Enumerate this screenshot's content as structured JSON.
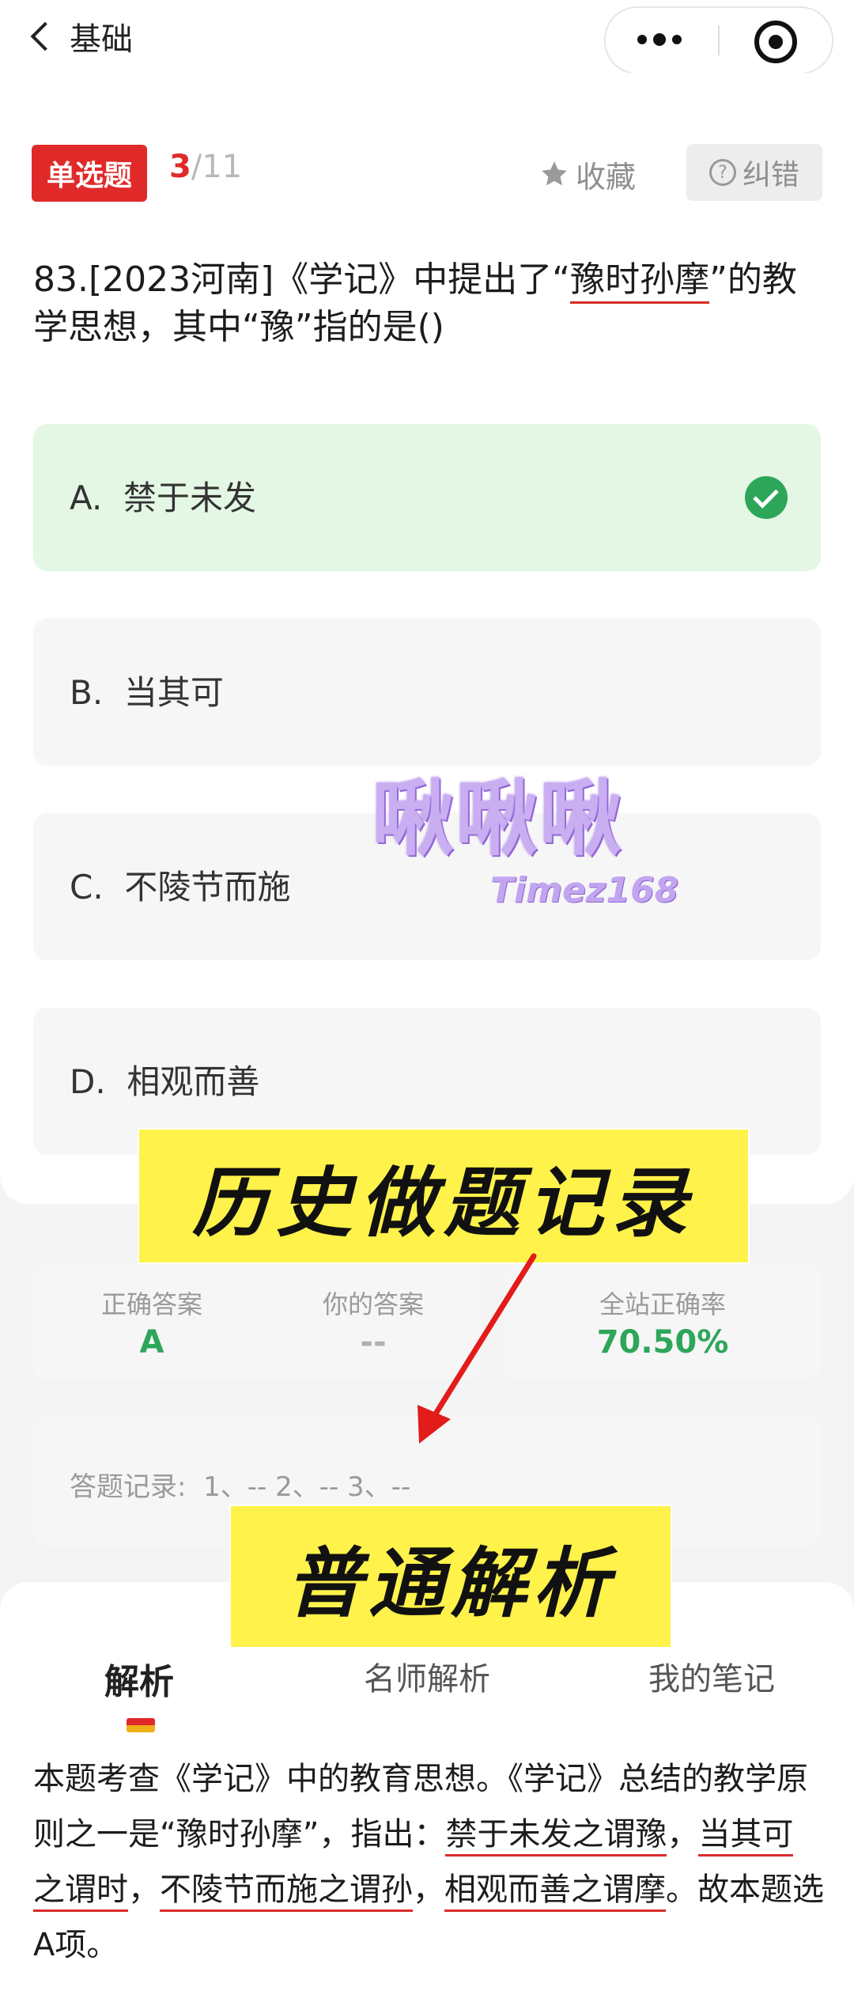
{
  "header": {
    "back_label": "基础"
  },
  "question": {
    "type_tag": "单选题",
    "current": "3",
    "total_sep": "/11",
    "favorite_label": "收藏",
    "report_label": "纠错",
    "text_before": "83.[2023河南]《学记》中提出了“",
    "text_highlight": "豫时孙摩",
    "text_after": "”的教学思想，其中“豫”指的是()"
  },
  "options": [
    {
      "letter": "A.",
      "label": "禁于未发",
      "status": "correct"
    },
    {
      "letter": "B.",
      "label": "当其可",
      "status": ""
    },
    {
      "letter": "C.",
      "label": "不陵节而施",
      "status": ""
    },
    {
      "letter": "D.",
      "label": "相观而善",
      "status": ""
    }
  ],
  "watermark": {
    "main": "啾啾啾",
    "sub": "Timez168"
  },
  "banners": {
    "history": "历史做题记录",
    "analysis": "普通解析"
  },
  "stats": {
    "correct_answer_label": "正确答案",
    "correct_answer_value": "A",
    "your_answer_label": "你的答案",
    "your_answer_value": "--",
    "site_rate_label": "全站正确率",
    "site_rate_value": "70.50%"
  },
  "record": {
    "label": "答题记录:",
    "entries": "1、--   2、--   3、--"
  },
  "tabs": [
    {
      "label": "解析",
      "active": true
    },
    {
      "label": "名师解析",
      "active": false
    },
    {
      "label": "我的笔记",
      "active": false
    }
  ],
  "analysis": {
    "p1": "本题考查《学记》中的教育思想。《学记》总结的教学原则之一是“豫时孙摩”，指出：",
    "u1": "禁于未发之谓豫",
    "s1": "，",
    "u2": "当其可之谓时",
    "s2": "，",
    "u3": "不陵节而施之谓孙",
    "s3": "，",
    "u4": "相观而善之谓摩",
    "p2": "。故本题选A项。"
  },
  "colors": {
    "accent_red": "#e02a2a",
    "correct_green": "#2ea65a",
    "banner_yellow": "#fff24a"
  }
}
